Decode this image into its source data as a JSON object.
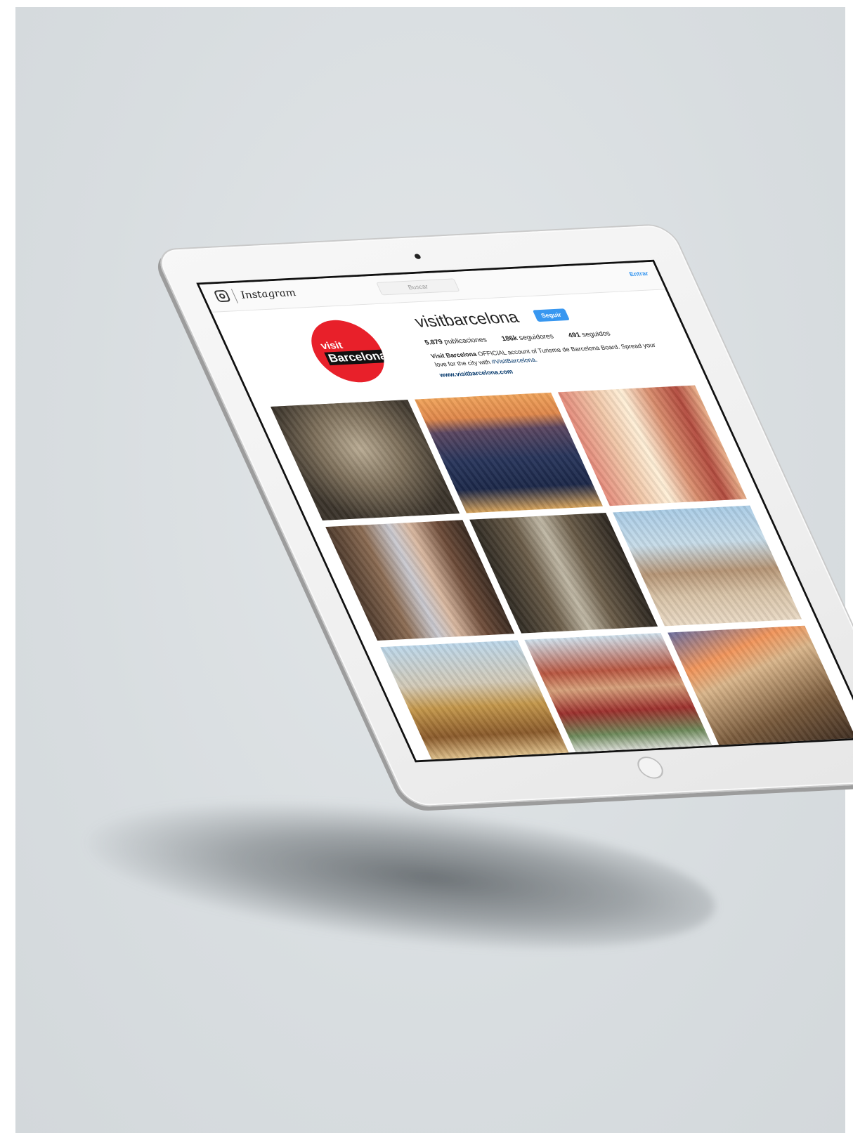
{
  "topbar": {
    "wordmark": "Instagram",
    "search_placeholder": "Buscar",
    "login_label": "Entrar"
  },
  "profile": {
    "avatar": {
      "line1": "visit",
      "line2": "Barcelona",
      "color": "#e8202a"
    },
    "username": "visitbarcelona",
    "follow_label": "Seguir",
    "stats": {
      "posts": "5.879",
      "posts_label": "publicaciones",
      "followers": "186k",
      "followers_label": "seguidores",
      "following": "491",
      "following_label": "seguidos"
    },
    "bio_name": "Visit Barcelona",
    "bio_text": "OFFICIAL account of Turisme de Barcelona Board. Spread your love for the city with",
    "bio_tag": "#VisitBarcelona.",
    "website": "www.visitbarcelona.com"
  },
  "grid": {
    "tiles": [
      {
        "subject": "aerial-city"
      },
      {
        "subject": "sunset-harbour"
      },
      {
        "subject": "colorful-columns"
      },
      {
        "subject": "narrow-street"
      },
      {
        "subject": "alley-view"
      },
      {
        "subject": "cathedral-rooftops"
      },
      {
        "subject": "carousel"
      },
      {
        "subject": "market-building"
      },
      {
        "subject": "casa-mila"
      }
    ]
  },
  "accent_color": "#3897f0"
}
